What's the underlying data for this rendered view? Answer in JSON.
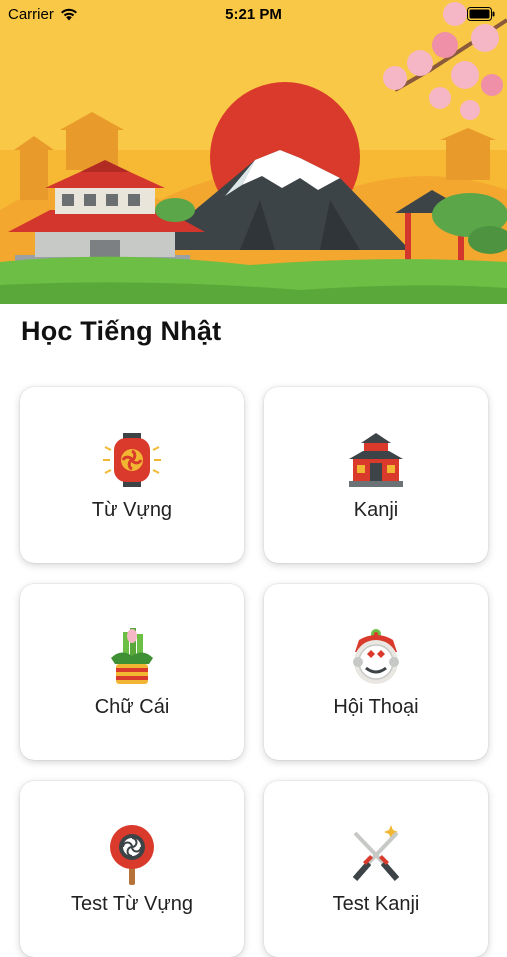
{
  "status_bar": {
    "carrier": "Carrier",
    "time": "5:21 PM"
  },
  "page": {
    "title": "Học Tiếng Nhật"
  },
  "menu": {
    "items": [
      {
        "label": "Từ Vựng",
        "icon": "paper-lantern-icon"
      },
      {
        "label": "Kanji",
        "icon": "japanese-temple-icon"
      },
      {
        "label": "Chữ Cái",
        "icon": "kadomatsu-icon"
      },
      {
        "label": "Hội Thoại",
        "icon": "lion-mask-icon"
      },
      {
        "label": "Test Từ Vựng",
        "icon": "uchiwa-fan-icon"
      },
      {
        "label": "Test Kanji",
        "icon": "crossed-swords-icon"
      }
    ]
  },
  "colors": {
    "sky": "#f9c846",
    "sun": "#d93a2b",
    "mountain": "#3d4448",
    "grass": "#6cbe45",
    "roof_red": "#d3362d",
    "blossom": "#f5b7c5"
  }
}
